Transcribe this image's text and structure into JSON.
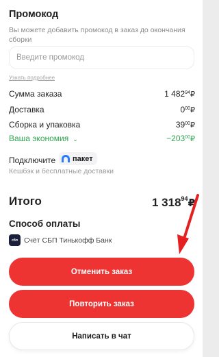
{
  "promo": {
    "title": "Промокод",
    "hint": "Вы можете добавить промокод в заказ до окончания сборки",
    "placeholder": "Введите промокод",
    "learn_more": "Узнать подробнее"
  },
  "summary": {
    "order_sum": {
      "label": "Сумма заказа",
      "value_main": "1 482",
      "value_sup": "94",
      "currency": "₽"
    },
    "delivery": {
      "label": "Доставка",
      "value_main": "0",
      "value_sup": "00",
      "currency": "₽"
    },
    "assembly": {
      "label": "Сборка и упаковка",
      "value_main": "39",
      "value_sup": "00",
      "currency": "₽"
    },
    "savings": {
      "label": "Ваша экономия",
      "chevron": "⌄",
      "value_main": "−203",
      "value_sup": "00",
      "currency": "₽"
    }
  },
  "paket": {
    "connect_label": "Подключите",
    "logo_text": "пакет",
    "cashback": "Кешбэк и бесплатные доставки"
  },
  "total": {
    "label": "Итого",
    "value_main": "1 318",
    "value_sup": "94",
    "currency": "₽"
  },
  "payment": {
    "title": "Способ оплаты",
    "method_icon_text": "сбп",
    "method_label": "Счёт СБП Тинькофф Банк"
  },
  "buttons": {
    "cancel": "Отменить заказ",
    "repeat": "Повторить заказ",
    "chat": "Написать в чат"
  },
  "colors": {
    "accent": "#ee3333",
    "savings": "#2ea44f"
  },
  "icons": {
    "chevron": "chevron-down-icon",
    "paket": "paket-logo-icon",
    "sbp": "sbp-icon"
  }
}
